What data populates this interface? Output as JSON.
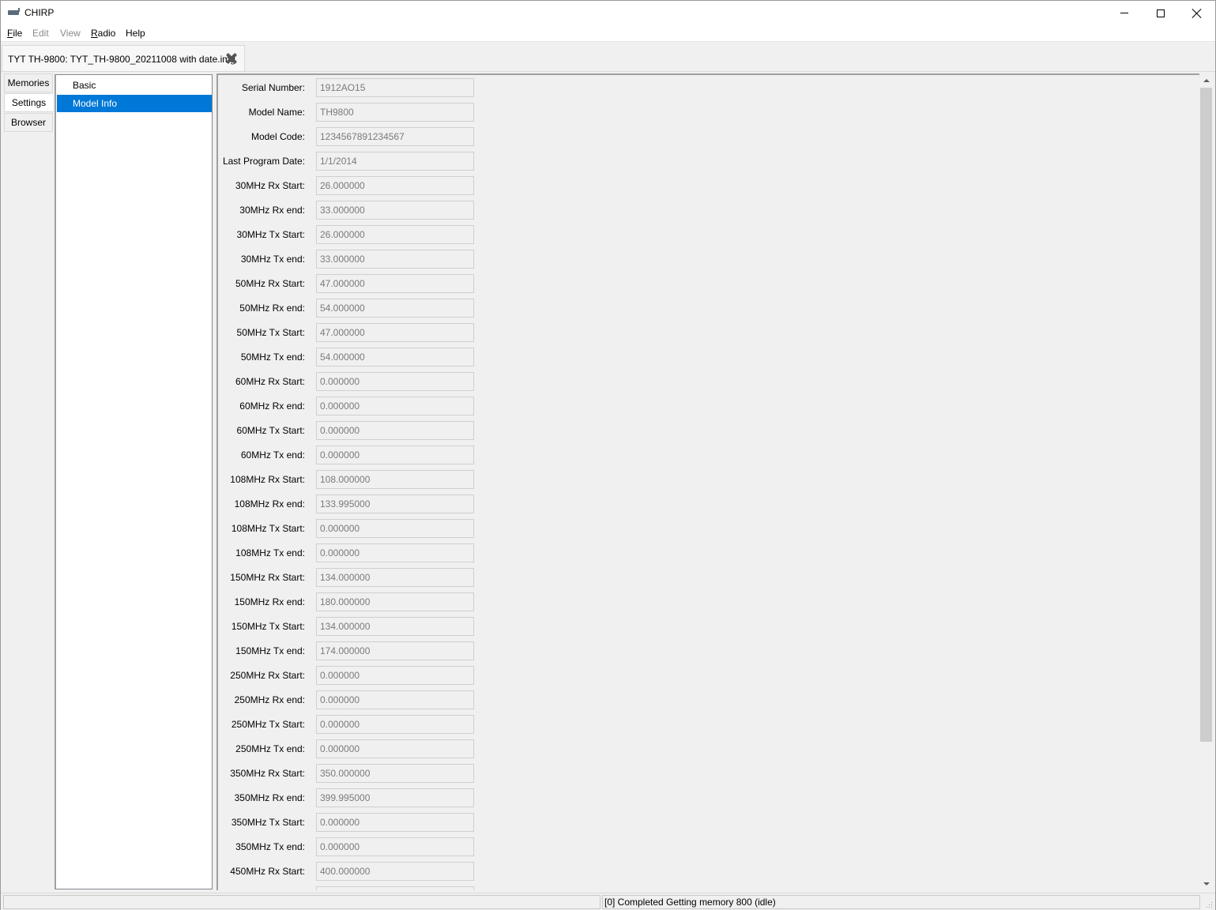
{
  "window": {
    "title": "CHIRP",
    "icon": "radio-app-icon"
  },
  "menu": {
    "file": "File",
    "edit": "Edit",
    "view": "View",
    "radio": "Radio",
    "help": "Help"
  },
  "file_tab": {
    "label": "TYT TH-9800: TYT_TH-9800_20211008 with date.img",
    "close_icon": "close-x-icon"
  },
  "side_tabs": {
    "memories": "Memories",
    "settings": "Settings",
    "browser": "Browser",
    "active": "Settings"
  },
  "tree": {
    "items": [
      "Basic",
      "Model Info"
    ],
    "selected": "Model Info"
  },
  "settings": {
    "fields": [
      {
        "label": "Serial Number:",
        "value": "1912AO15"
      },
      {
        "label": "Model Name:",
        "value": "TH9800"
      },
      {
        "label": "Model Code:",
        "value": "1234567891234567"
      },
      {
        "label": "Last Program Date:",
        "value": "1/1/2014"
      },
      {
        "label": "30MHz Rx Start:",
        "value": "26.000000"
      },
      {
        "label": "30MHz Rx end:",
        "value": "33.000000"
      },
      {
        "label": "30MHz Tx Start:",
        "value": "26.000000"
      },
      {
        "label": "30MHz Tx end:",
        "value": "33.000000"
      },
      {
        "label": "50MHz Rx Start:",
        "value": "47.000000"
      },
      {
        "label": "50MHz Rx end:",
        "value": "54.000000"
      },
      {
        "label": "50MHz Tx Start:",
        "value": "47.000000"
      },
      {
        "label": "50MHz Tx end:",
        "value": "54.000000"
      },
      {
        "label": "60MHz Rx Start:",
        "value": "0.000000"
      },
      {
        "label": "60MHz Rx end:",
        "value": "0.000000"
      },
      {
        "label": "60MHz Tx Start:",
        "value": "0.000000"
      },
      {
        "label": "60MHz Tx end:",
        "value": "0.000000"
      },
      {
        "label": "108MHz Rx Start:",
        "value": "108.000000"
      },
      {
        "label": "108MHz Rx end:",
        "value": "133.995000"
      },
      {
        "label": "108MHz Tx Start:",
        "value": "0.000000"
      },
      {
        "label": "108MHz Tx end:",
        "value": "0.000000"
      },
      {
        "label": "150MHz Rx Start:",
        "value": "134.000000"
      },
      {
        "label": "150MHz Rx end:",
        "value": "180.000000"
      },
      {
        "label": "150MHz Tx Start:",
        "value": "134.000000"
      },
      {
        "label": "150MHz Tx end:",
        "value": "174.000000"
      },
      {
        "label": "250MHz Rx Start:",
        "value": "0.000000"
      },
      {
        "label": "250MHz Rx end:",
        "value": "0.000000"
      },
      {
        "label": "250MHz Tx Start:",
        "value": "0.000000"
      },
      {
        "label": "250MHz Tx end:",
        "value": "0.000000"
      },
      {
        "label": "350MHz Rx Start:",
        "value": "350.000000"
      },
      {
        "label": "350MHz Rx end:",
        "value": "399.995000"
      },
      {
        "label": "350MHz Tx Start:",
        "value": "0.000000"
      },
      {
        "label": "350MHz Tx end:",
        "value": "0.000000"
      },
      {
        "label": "450MHz Rx Start:",
        "value": "400.000000"
      },
      {
        "label": "",
        "value": ""
      }
    ]
  },
  "status": {
    "left": "",
    "right": "[0] Completed Getting memory 800 (idle)"
  }
}
